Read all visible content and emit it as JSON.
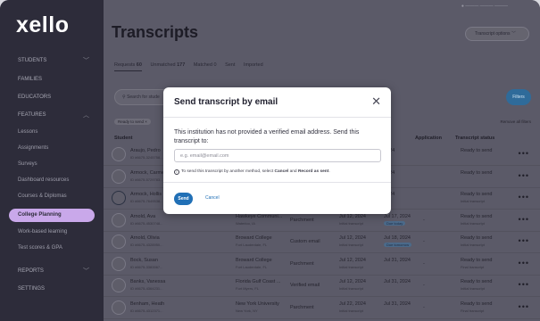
{
  "app": {
    "logo": "xello"
  },
  "sidebar": {
    "items": [
      {
        "label": "STUDENTS",
        "chevron": "﹀"
      },
      {
        "label": "FAMILIES"
      },
      {
        "label": "EDUCATORS"
      },
      {
        "label": "FEATURES",
        "chevron": "︿"
      },
      {
        "label": "Lessons"
      },
      {
        "label": "Assignments"
      },
      {
        "label": "Surveys"
      },
      {
        "label": "Dashboard resources"
      },
      {
        "label": "Courses & Diplomas"
      },
      {
        "label": "College Planning"
      },
      {
        "label": "Work-based learning"
      },
      {
        "label": "Test scores & GPA"
      },
      {
        "label": "REPORTS",
        "chevron": "﹀"
      },
      {
        "label": "SETTINGS"
      }
    ]
  },
  "header": {
    "top_right": "● ——— ——— ———",
    "title": "Transcripts",
    "options_button": "Transcript options  ﹀"
  },
  "tabs": [
    {
      "label": "Requests",
      "count": "60"
    },
    {
      "label": "Unmatched",
      "count": "177"
    },
    {
      "label": "Matched",
      "count": "0"
    },
    {
      "label": "Sent",
      "count": ""
    },
    {
      "label": "Imported",
      "count": ""
    }
  ],
  "search": {
    "placeholder": "Search for stude"
  },
  "filters_button": "Filters",
  "filter_chip": "Ready to send  ×",
  "remove_filters": "Remove all filters",
  "columns": {
    "student": "Student",
    "application": "Application",
    "status": "Transcript status"
  },
  "rows": [
    {
      "name": "Araujo, Pedro",
      "id": "ID #6675-3245758...",
      "inst": "",
      "loc": "",
      "method": "",
      "date1": "",
      "date1_sub": "",
      "date2": "2024",
      "due": "",
      "app": "",
      "status": "Ready to send",
      "status_sub": ""
    },
    {
      "name": "Armock, Carmen",
      "id": "ID #6675-5729783...",
      "inst": "",
      "loc": "",
      "method": "",
      "date1": "",
      "date1_sub": "",
      "date2": "2024",
      "due": "",
      "app": "",
      "status": "Ready to send",
      "status_sub": ""
    },
    {
      "name": "Armock, Hollis",
      "id": "ID #6675-7649538...",
      "inst": "",
      "loc": "",
      "method": "",
      "date1": "",
      "date1_sub": "",
      "date2": "2024",
      "due": "",
      "app": "",
      "status": "Ready to send",
      "status_sub": "Initial transcript"
    },
    {
      "name": "Arnold, Ava",
      "id": "ID #6675-4530748...",
      "inst": "Hawkeye Communi...",
      "loc": "Waterloo, IA",
      "method": "Parchment",
      "date1": "Jul 12, 2024",
      "date1_sub": "Initial transcript",
      "date2": "Jul 17, 2024",
      "due": "Due today",
      "app": "-",
      "status": "Ready to send",
      "status_sub": "Initial transcript"
    },
    {
      "name": "Arnold, Olivia",
      "id": "ID #6675-4328950...",
      "inst": "Broward College",
      "loc": "Fort Lauderdale, FL",
      "method": "Custom email",
      "date1": "Jul 12, 2024",
      "date1_sub": "Initial transcript",
      "date2": "Jul 18, 2024",
      "due": "Due tomorrow",
      "app": "-",
      "status": "Ready to send",
      "status_sub": "Initial transcript"
    },
    {
      "name": "Bock, Susan",
      "id": "ID #6675-3383567...",
      "inst": "Broward College",
      "loc": "Fort Lauderdale, FL",
      "method": "Parchment",
      "date1": "Jul 12, 2024",
      "date1_sub": "Initial transcript",
      "date2": "Jul 31, 2024",
      "due": "",
      "app": "-",
      "status": "Ready to send",
      "status_sub": "Final transcript"
    },
    {
      "name": "Banks, Vanessa",
      "id": "ID #6675-4364231...",
      "inst": "Florida Gulf Coast ...",
      "loc": "Fort Myers, FL",
      "method": "Verified email",
      "date1": "Jul 12, 2024",
      "date1_sub": "Initial transcript",
      "date2": "Jul 31, 2024",
      "due": "",
      "app": "-",
      "status": "Ready to send",
      "status_sub": "Initial transcript"
    },
    {
      "name": "Benham, Heath",
      "id": "ID #6675-4312371...",
      "inst": "New York University",
      "loc": "New York, NY",
      "method": "Parchment",
      "date1": "Jul 22, 2024",
      "date1_sub": "Initial transcript",
      "date2": "Jul 31, 2024",
      "due": "",
      "app": "-",
      "status": "Ready to send",
      "status_sub": "Final transcript"
    }
  ],
  "modal": {
    "title": "Send transcript by email",
    "close_glyph": "✕",
    "message": "This institution has not provided a verified email address. Send this transcript to:",
    "email_placeholder": "e.g. email@email.com",
    "email_value": "",
    "info_icon_glyph": "i",
    "info_prefix": "To send this transcript by another method, select ",
    "info_cancel": "Cancel",
    "info_mid": " and ",
    "info_record": "Record as sent",
    "info_suffix": ".",
    "send_label": "Send",
    "cancel_label": "Cancel"
  },
  "colors": {
    "accent": "#2170b6",
    "sidebar_bg": "#2d2c3a",
    "active_nav": "#c9a8ea"
  }
}
